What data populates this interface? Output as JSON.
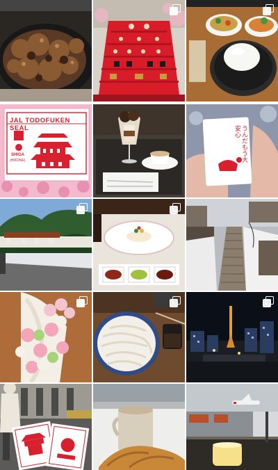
{
  "feed": {
    "columns": 3,
    "rows": 5,
    "posts": [
      {
        "id": "post-1",
        "subject": "grilled-chicken-skillet",
        "multi": false
      },
      {
        "id": "post-2",
        "subject": "hina-doll-display",
        "multi": true
      },
      {
        "id": "post-3",
        "subject": "curry-rice-table",
        "multi": true
      },
      {
        "id": "post-4",
        "subject": "castle-seal-stamp",
        "multi": false
      },
      {
        "id": "post-5",
        "subject": "parfait-and-coffee",
        "multi": false
      },
      {
        "id": "post-6",
        "subject": "goshuin-card",
        "multi": false
      },
      {
        "id": "post-7",
        "subject": "shrine-hillside",
        "multi": true
      },
      {
        "id": "post-8",
        "subject": "plated-dessert",
        "multi": true
      },
      {
        "id": "post-9",
        "subject": "snowy-stairs",
        "multi": false
      },
      {
        "id": "post-10",
        "subject": "dango-soft-serve",
        "multi": true
      },
      {
        "id": "post-11",
        "subject": "udon-bowl",
        "multi": true
      },
      {
        "id": "post-12",
        "subject": "night-city-tower",
        "multi": true
      },
      {
        "id": "post-13",
        "subject": "street-with-stamps",
        "multi": false
      },
      {
        "id": "post-14",
        "subject": "coffee-croissant",
        "multi": false
      },
      {
        "id": "post-15",
        "subject": "airport-runway-candle",
        "multi": false
      }
    ]
  },
  "stamp": {
    "title": "JAL TODOFUKEN SEAL",
    "prefecture": "SHIGA",
    "city": "(HIKONE)"
  },
  "goshuin": {
    "text": "うんだもう大安心"
  }
}
